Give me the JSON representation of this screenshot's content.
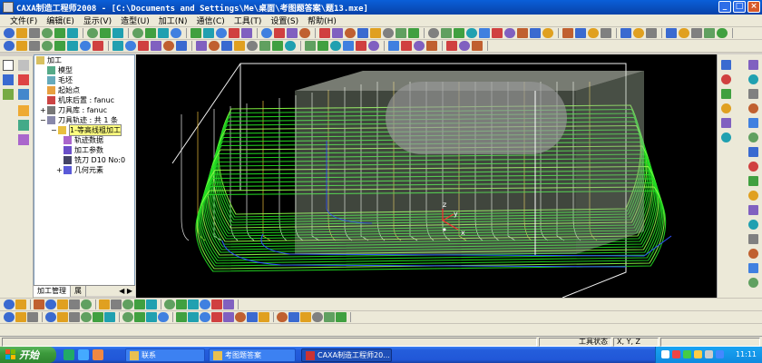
{
  "window": {
    "title": "CAXA制造工程师2008 - [C:\\Documents and Settings\\Me\\桌面\\考图题答案\\题13.mxe]",
    "controls": [
      "_",
      "□",
      "×"
    ]
  },
  "menu": [
    "文件(F)",
    "编辑(E)",
    "显示(V)",
    "造型(U)",
    "加工(N)",
    "通信(C)",
    "工具(T)",
    "设置(S)",
    "帮助(H)"
  ],
  "tree": {
    "items": [
      {
        "label": "加工",
        "icon": "folder-icon",
        "level": 0
      },
      {
        "label": "模型",
        "icon": "model-icon",
        "level": 1
      },
      {
        "label": "毛坯",
        "icon": "blank-icon",
        "level": 1
      },
      {
        "label": "起始点",
        "icon": "start-point-icon",
        "level": 1
      },
      {
        "label": "机床后置 : fanuc",
        "icon": "machine-icon",
        "level": 1
      },
      {
        "label": "刀具库 : fanuc",
        "icon": "tool-library-icon",
        "level": 1
      },
      {
        "label": "刀具轨迹 : 共 1 条",
        "icon": "toolpath-icon",
        "level": 1
      },
      {
        "label": "1-等高线粗加工",
        "icon": "operation-icon",
        "level": 2,
        "selected": true
      },
      {
        "label": "轨迹数据",
        "icon": "path-data-icon",
        "level": 3
      },
      {
        "label": "加工参数",
        "icon": "params-icon",
        "level": 3
      },
      {
        "label": "铣刀 D10 No:0",
        "icon": "cutter-icon",
        "level": 3
      },
      {
        "label": "几何元素",
        "icon": "geometry-icon",
        "level": 3
      }
    ],
    "tabs": [
      "加工管理",
      "属"
    ]
  },
  "viewport": {
    "axis_labels": {
      "x": "x",
      "y": "y",
      "z": "z"
    },
    "colors": {
      "background": "#000000",
      "toolpath": "#22dd22",
      "blank": "#e8e8e8",
      "part": "#b8c8b0"
    }
  },
  "status": {
    "tool_state": "工具状态",
    "coords": "X, Y, Z"
  },
  "taskbar": {
    "start_label": "开始",
    "buttons": [
      {
        "label": "联系",
        "active": false
      },
      {
        "label": "考图题答案",
        "active": false
      },
      {
        "label": "CAXA制造工程师20...",
        "active": true
      }
    ],
    "clock": "11:11"
  }
}
